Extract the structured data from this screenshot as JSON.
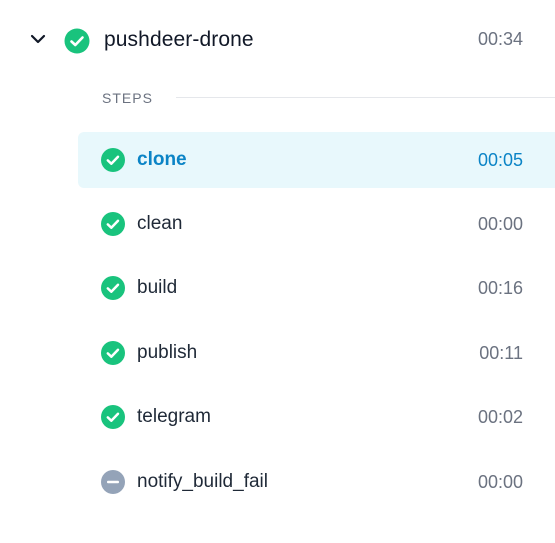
{
  "colors": {
    "success": "#19c37d",
    "skipped": "#94a3b8",
    "active_bg": "#e8f8fc",
    "active_text": "#0b84c6"
  },
  "pipeline": {
    "name": "pushdeer-drone",
    "duration": "00:34",
    "status_icon": "check-circle-icon",
    "expand_icon": "chevron-down-icon"
  },
  "steps_header": "STEPS",
  "steps": [
    {
      "name": "clone",
      "duration": "00:05",
      "status": "success",
      "active": true
    },
    {
      "name": "clean",
      "duration": "00:00",
      "status": "success",
      "active": false
    },
    {
      "name": "build",
      "duration": "00:16",
      "status": "success",
      "active": false
    },
    {
      "name": "publish",
      "duration": "00:11",
      "status": "success",
      "active": false
    },
    {
      "name": "telegram",
      "duration": "00:02",
      "status": "success",
      "active": false
    },
    {
      "name": "notify_build_fail",
      "duration": "00:00",
      "status": "skipped",
      "active": false
    }
  ]
}
